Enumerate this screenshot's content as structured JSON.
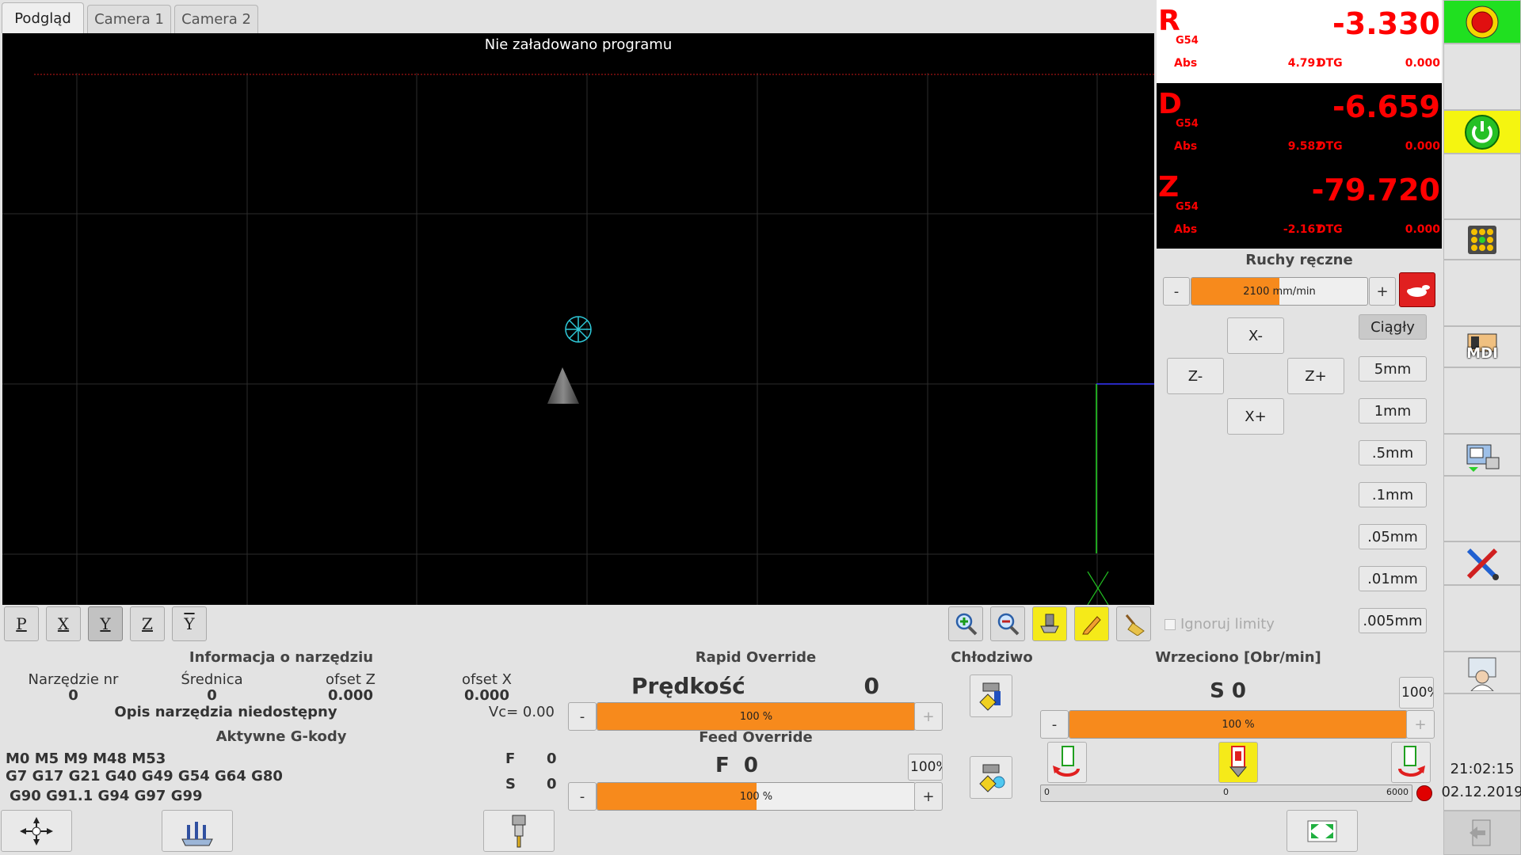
{
  "tabs": [
    {
      "label": "Podgląd"
    },
    {
      "label": "Camera 1"
    },
    {
      "label": "Camera 2"
    }
  ],
  "preview": {
    "message": "Nie załadowano programu"
  },
  "view_buttons": {
    "p": "P",
    "x": "X",
    "y": "Y",
    "z": "Z",
    "y2": "Y"
  },
  "dro": [
    {
      "axis": "R",
      "coord": "G54",
      "value": "-3.330",
      "abs_label": "Abs",
      "abs": "4.791",
      "dtg_label": "DTG",
      "dtg": "0.000"
    },
    {
      "axis": "D",
      "coord": "G54",
      "value": "-6.659",
      "abs_label": "Abs",
      "abs": "9.582",
      "dtg_label": "DTG",
      "dtg": "0.000"
    },
    {
      "axis": "Z",
      "coord": "G54",
      "value": "-79.720",
      "abs_label": "Abs",
      "abs": "-2.167",
      "dtg_label": "DTG",
      "dtg": "0.000"
    }
  ],
  "jog": {
    "title": "Ruchy ręczne",
    "minus": "-",
    "plus": "+",
    "speed": "2100 mm/min",
    "speed_fraction": 0.5,
    "x_minus": "X-",
    "x_plus": "X+",
    "z_minus": "Z-",
    "z_plus": "Z+",
    "increments": [
      "Ciągły",
      "5mm",
      "1mm",
      ".5mm",
      ".1mm",
      ".05mm",
      ".01mm",
      ".005mm"
    ],
    "ignore_limits": "Ignoruj limity"
  },
  "sidebar": {
    "mdi_label": "MDI",
    "time": "21:02:15",
    "date": "02.12.2019"
  },
  "tool_info": {
    "title": "Informacja o narzędziu",
    "tool_nr_label": "Narzędzie nr",
    "tool_nr": "0",
    "diameter_label": "Średnica",
    "diameter": "0",
    "offset_z_label": "ofset Z",
    "offset_z": "0.000",
    "offset_x_label": "ofset X",
    "offset_x": "0.000",
    "description": "Opis narzędzia niedostępny",
    "vc": "Vc= 0.00"
  },
  "gcodes": {
    "title": "Aktywne G-kody",
    "line1": "M0 M5 M9 M48 M53",
    "line2": "G7 G17 G21 G40 G49 G54 G64 G80",
    "line3": "G90 G91.1 G94 G97 G99",
    "f_label": "F",
    "f_value": "0",
    "s_label": "S",
    "s_value": "0"
  },
  "rapid": {
    "title": "Rapid Override",
    "speed_label": "Prędkość",
    "speed_value": "0",
    "minus": "-",
    "plus": "+",
    "percent": "100 %",
    "fraction": 1.0
  },
  "feed": {
    "title": "Feed Override",
    "value": "F  0",
    "reset": "100%",
    "minus": "-",
    "plus": "+",
    "percent": "100 %",
    "fraction": 0.5
  },
  "coolant": {
    "title": "Chłodziwo"
  },
  "spindle": {
    "title": "Wrzeciono [Obr/min]",
    "value": "S 0",
    "reset": "100%",
    "minus": "-",
    "plus": "+",
    "percent": "100 %",
    "fraction": 1.0,
    "scale_min": "0",
    "scale_mid": "0",
    "scale_max": "6000"
  }
}
